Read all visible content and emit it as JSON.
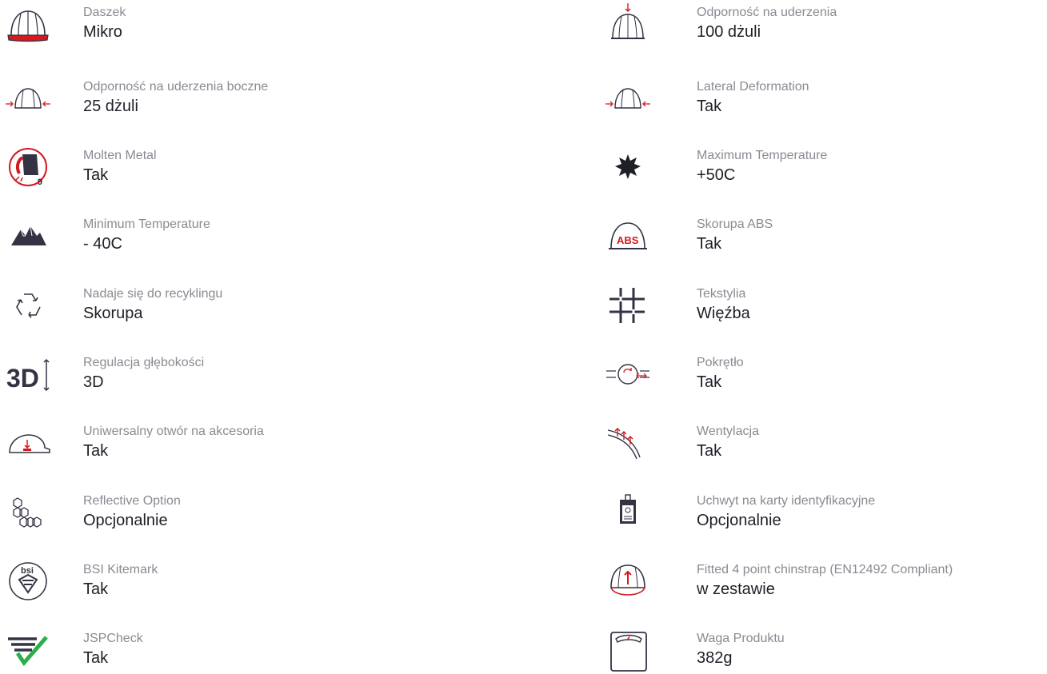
{
  "colors": {
    "label": "#8a8a93",
    "value": "#1f1f28",
    "icon_stroke": "#333344",
    "accent_red": "#d4191f",
    "accent_green": "#2eae4a"
  },
  "left_column": [
    {
      "icon": "hard-hat-peak-icon",
      "label": "Daszek",
      "value": "Mikro"
    },
    {
      "icon": "lateral-impact-icon",
      "label": "Odporność na uderzenia boczne",
      "value": "25 dżuli"
    },
    {
      "icon": "molten-metal-icon",
      "label": "Molten Metal",
      "value": "Tak"
    },
    {
      "icon": "mountains-icon",
      "label": "Minimum Temperature",
      "value": "- 40C"
    },
    {
      "icon": "recycle-icon",
      "label": "Nadaje się do recyklingu",
      "value": "Skorupa"
    },
    {
      "icon": "depth-3d-icon",
      "label": "Regulacja głębokości",
      "value": "3D"
    },
    {
      "icon": "accessory-slot-icon",
      "label": "Uniwersalny otwór na akcesoria",
      "value": "Tak"
    },
    {
      "icon": "hexagons-icon",
      "label": "Reflective Option",
      "value": "Opcjonalnie"
    },
    {
      "icon": "bsi-kitemark-icon",
      "label": "BSI Kitemark",
      "value": "Tak"
    },
    {
      "icon": "jspcheck-icon",
      "label": "JSPCheck",
      "value": "Tak"
    }
  ],
  "right_column": [
    {
      "icon": "top-impact-icon",
      "label": "Odporność na uderzenia",
      "value": "100 dżuli"
    },
    {
      "icon": "lateral-deformation-icon",
      "label": "Lateral Deformation",
      "value": "Tak"
    },
    {
      "icon": "sun-icon",
      "label": "Maximum Temperature",
      "value": "+50C"
    },
    {
      "icon": "abs-shell-icon",
      "label": "Skorupa ABS",
      "value": "Tak"
    },
    {
      "icon": "textile-icon",
      "label": "Tekstylia",
      "value": "Więźba"
    },
    {
      "icon": "dial-icon",
      "label": "Pokrętło",
      "value": "Tak"
    },
    {
      "icon": "ventilation-icon",
      "label": "Wentylacja",
      "value": "Tak"
    },
    {
      "icon": "id-card-holder-icon",
      "label": "Uchwyt na karty identyfikacyjne",
      "value": "Opcjonalnie"
    },
    {
      "icon": "chinstrap-icon",
      "label": "Fitted 4 point chinstrap (EN12492 Compliant)",
      "value": "w zestawie"
    },
    {
      "icon": "weight-scale-icon",
      "label": "Waga Produktu",
      "value": "382g"
    }
  ],
  "icon_texts": {
    "abs": "ABS",
    "bsi": "bsi",
    "depth": "3D",
    "molten_number": "9"
  }
}
